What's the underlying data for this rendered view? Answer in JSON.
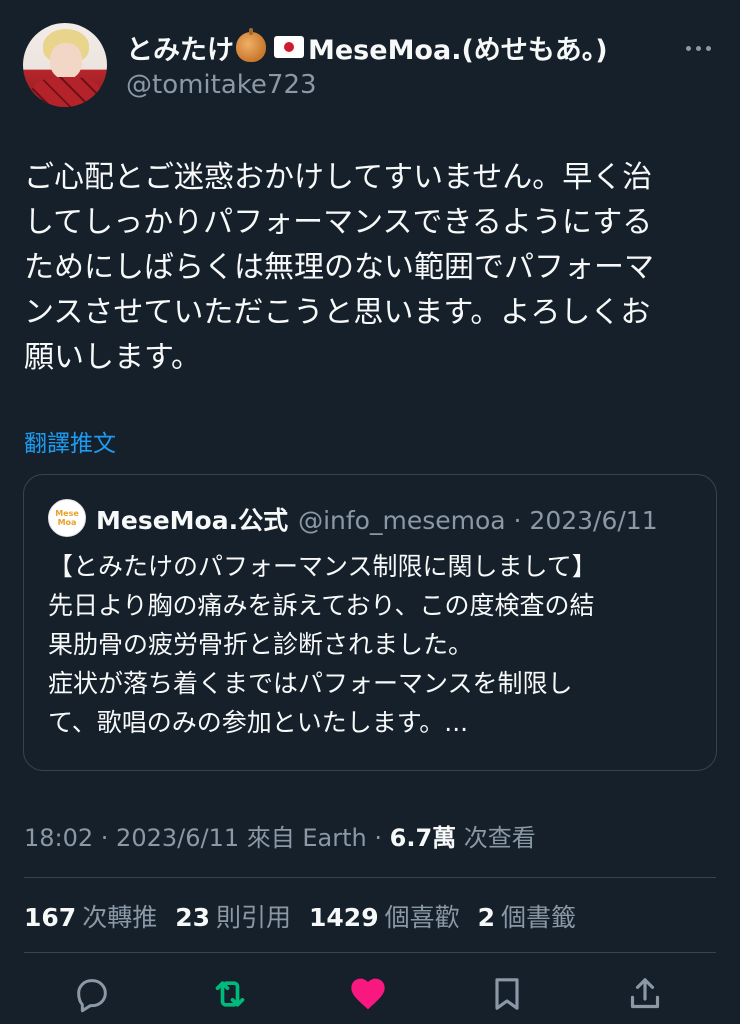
{
  "author": {
    "name": "とみたけ",
    "name_suffix": "MeseMoa.(めせもあ。)",
    "handle": "@tomitake723",
    "emoji_icons": [
      "onion-icon",
      "japan-flag-icon"
    ]
  },
  "tweet": {
    "lines": [
      "ご心配とご迷惑おかけしてすいません。早く治",
      "してしっかりパフォーマンスできるようにする",
      "ためにしばらくは無理のない範囲でパフォーマ",
      "ンスさせていただこうと思います。よろしくお",
      "願いします。"
    ],
    "translate_label": "翻譯推文"
  },
  "quote": {
    "avatar_text": "Mese Moa",
    "name": "MeseMoa.公式",
    "handle_date": "@info_mesemoa · 2023/6/11",
    "lines": [
      "【とみたけのパフォーマンス制限に関しまして】",
      "先日より胸の痛みを訴えており、この度検査の結",
      "果肋骨の疲労骨折と診断されました。",
      "症状が落ち着くまではパフォーマンスを制限し",
      "て、歌唱のみの参加といたします。..."
    ]
  },
  "meta": {
    "time_source": "18:02 · 2023/6/11 來自 Earth · ",
    "views_count": "6.7萬",
    "views_label": " 次查看"
  },
  "stats": {
    "retweets_count": "167",
    "retweets_label": "次轉推",
    "quotes_count": "23",
    "quotes_label": "則引用",
    "likes_count": "1429",
    "likes_label": "個喜歡",
    "bookmarks_count": "2",
    "bookmarks_label": "個書籤"
  },
  "actions": [
    "reply-icon",
    "retweet-icon",
    "like-icon",
    "bookmark-icon",
    "share-icon"
  ],
  "colors": {
    "background": "#15202b",
    "text": "#f7f9f9",
    "secondary": "#8b98a5",
    "link": "#1d9bf0",
    "retweet": "#00ba7c",
    "like": "#f91880",
    "border": "#38444d"
  }
}
